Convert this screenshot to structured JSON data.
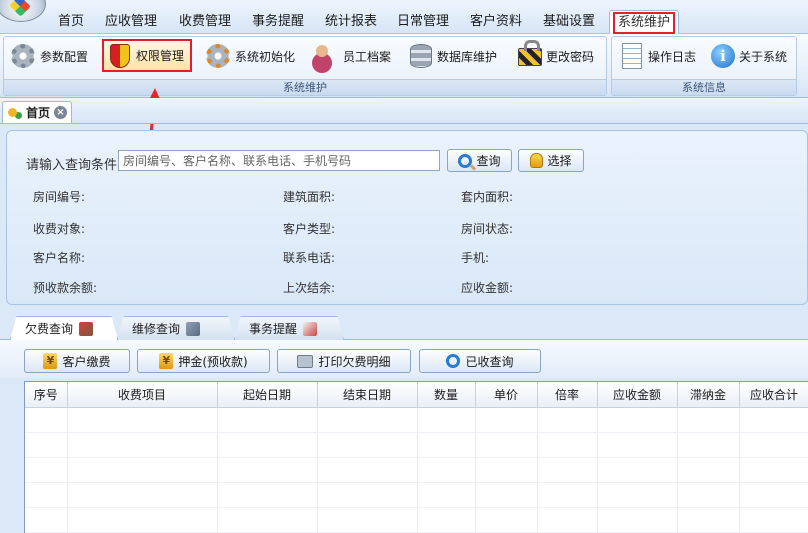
{
  "menubar": {
    "items": [
      "首页",
      "应收管理",
      "收费管理",
      "事务提醒",
      "统计报表",
      "日常管理",
      "客户资料",
      "基础设置",
      "系统维护"
    ],
    "active": "系统维护"
  },
  "ribbon": {
    "group_maintenance": {
      "title": "系统维护",
      "buttons": [
        {
          "label": "参数配置",
          "icon": "gear-icon"
        },
        {
          "label": "权限管理",
          "icon": "shield-icon"
        },
        {
          "label": "系统初始化",
          "icon": "gears-icon"
        },
        {
          "label": "员工档案",
          "icon": "people-icon"
        },
        {
          "label": "数据库维护",
          "icon": "database-icon"
        },
        {
          "label": "更改密码",
          "icon": "lock-icon"
        }
      ]
    },
    "group_info": {
      "title": "系统信息",
      "buttons": [
        {
          "label": "操作日志",
          "icon": "log-icon"
        },
        {
          "label": "关于系统",
          "icon": "info-icon"
        }
      ]
    }
  },
  "doc_tab": {
    "label": "首页"
  },
  "query": {
    "prompt": "请输入查询条件",
    "placeholder": "房间编号、客户名称、联系电话、手机号码",
    "search_label": "查询",
    "select_label": "选择"
  },
  "info_fields": [
    "房间编号:",
    "建筑面积:",
    "套内面积:",
    "收费对象:",
    "客户类型:",
    "房间状态:",
    "客户名称:",
    "联系电话:",
    "手机:",
    "预收款余额:",
    "上次结余:",
    "应收金额:"
  ],
  "tabs": [
    "欠费查询",
    "维修查询",
    "事务提醒"
  ],
  "actions": [
    "客户缴费",
    "押金(预收款)",
    "打印欠费明细",
    "已收查询"
  ],
  "table": {
    "columns": [
      "序号",
      "收费项目",
      "起始日期",
      "结束日期",
      "数量",
      "单价",
      "倍率",
      "应收金额",
      "滞纳金",
      "应收合计"
    ]
  }
}
